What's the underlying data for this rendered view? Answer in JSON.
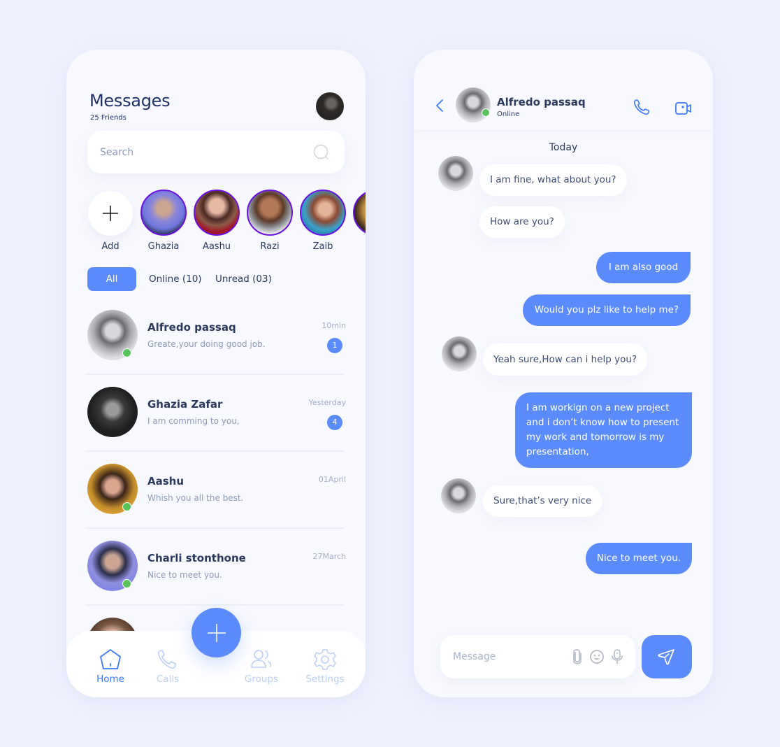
{
  "colors": {
    "accent": "#5b8bfd",
    "background": "#eef1fc",
    "card": "#f8f9fe",
    "online": "#5ac45c",
    "story_ring": "#6a12e0",
    "text_primary": "#2b3a5e",
    "text_muted": "#8e9ab8"
  },
  "messages_screen": {
    "title": "Messages",
    "subtitle": "25 Friends",
    "profile_avatar": "profile-avatar",
    "search": {
      "placeholder": "Search",
      "value": "",
      "icon": "search-icon"
    },
    "stories": [
      {
        "label": "Add",
        "type": "add",
        "icon": "plus-icon"
      },
      {
        "label": "Ghazia"
      },
      {
        "label": "Aashu"
      },
      {
        "label": "Razi"
      },
      {
        "label": "Zaib"
      },
      {
        "label": ""
      }
    ],
    "filters": [
      {
        "label": "All",
        "active": true
      },
      {
        "label": "Online (10)",
        "active": false
      },
      {
        "label": "Unread (03)",
        "active": false
      }
    ],
    "chats": [
      {
        "name": "Alfredo passaq",
        "preview": "Greate,your doing good  job.",
        "time": "10min",
        "unread": "1",
        "online": true
      },
      {
        "name": "Ghazia Zafar",
        "preview": "I am comming to you,",
        "time": "Yesterday",
        "unread": "4",
        "online": false
      },
      {
        "name": "Aashu",
        "preview": "Whish you all the best.",
        "time": "01April",
        "unread": "",
        "online": true
      },
      {
        "name": "Charli stonthone",
        "preview": "Nice to meet you.",
        "time": "27March",
        "unread": "",
        "online": true
      }
    ],
    "nav": [
      {
        "label": "Home",
        "icon": "home-icon",
        "active": true
      },
      {
        "label": "Calls",
        "icon": "phone-icon",
        "active": false
      },
      {
        "label": "Groups",
        "icon": "groups-icon",
        "active": false
      },
      {
        "label": "Settings",
        "icon": "settings-icon",
        "active": false
      }
    ],
    "fab_icon": "plus-icon"
  },
  "chat_screen": {
    "contact_name": "Alfredo passaq",
    "contact_status": "Online",
    "day_label": "Today",
    "messages": [
      {
        "direction": "in",
        "text": "I am fine, what about you?",
        "avatar": true
      },
      {
        "direction": "in",
        "text": "How are you?",
        "avatar": false
      },
      {
        "direction": "out",
        "text": "I am also good"
      },
      {
        "direction": "out",
        "text": "Would you plz like to help me?"
      },
      {
        "direction": "in",
        "text": "Yeah sure,How can i help you?",
        "avatar": true
      },
      {
        "direction": "out",
        "text": "I am workign on a new project and i don’t know how to present my work and tomorrow is my presentation,"
      },
      {
        "direction": "in",
        "text": "Sure,that’s very nice",
        "avatar": true
      },
      {
        "direction": "out",
        "text": "Nice to meet you."
      }
    ],
    "composer": {
      "placeholder": "Message",
      "value": ""
    }
  }
}
